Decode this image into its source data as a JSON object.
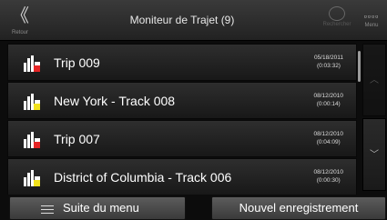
{
  "header": {
    "back_glyph": "《",
    "back_label": "Retour",
    "title": "Moniteur de Trajet (9)",
    "search_label": "Rechercher",
    "menu_glyph": "▫▫▫▫",
    "menu_label": "Menu"
  },
  "trips": [
    {
      "name": "Trip 009",
      "date": "05/18/2011",
      "duration": "(0:03:32)"
    },
    {
      "name": "New York - Track 008",
      "date": "08/12/2010",
      "duration": "(0:00:14)"
    },
    {
      "name": "Trip 007",
      "date": "08/12/2010",
      "duration": "(0:04:09)"
    },
    {
      "name": "District of Columbia - Track 006",
      "date": "08/12/2010",
      "duration": "(0:00:30)"
    }
  ],
  "scroll": {
    "up_glyph": "︿",
    "down_glyph": "﹀"
  },
  "footer": {
    "more_label": "Suite du menu",
    "new_recording_label": "Nouvel enregistrement"
  },
  "colors": {
    "status_red": "#e52525",
    "status_yellow": "#f2e21c"
  },
  "icons": [
    "back-icon",
    "search-icon",
    "menu-grid-icon",
    "trip-log-icon",
    "menu-lines-icon",
    "scroll-up-icon",
    "scroll-down-icon"
  ]
}
